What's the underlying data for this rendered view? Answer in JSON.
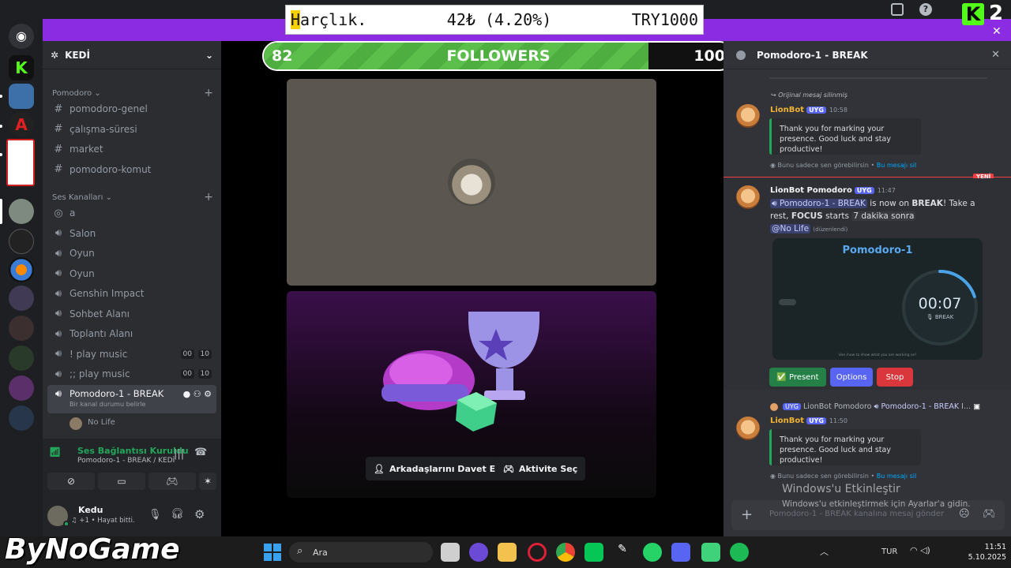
{
  "overlay": {
    "word_initial": "H",
    "word_rest": "arçlık.",
    "amount": "42₺ (4.20%)",
    "goal": "TRY1000"
  },
  "followers": {
    "current": "82",
    "label": "FOLLOWERS",
    "goal": "100",
    "progress_fraction": 0.82
  },
  "kick_count": "2",
  "server": {
    "name": "KEDİ"
  },
  "categories": {
    "text": "Pomodoro",
    "voice": "Ses Kanalları"
  },
  "text_channels": [
    "pomodoro-genel",
    "çalışma-süresi",
    "market",
    "pomodoro-komut"
  ],
  "voice_channels": [
    {
      "name": "a",
      "counts": null
    },
    {
      "name": "Salon",
      "counts": null
    },
    {
      "name": "Oyun",
      "counts": null
    },
    {
      "name": "Oyun",
      "counts": null
    },
    {
      "name": "Genshin Impact",
      "counts": null
    },
    {
      "name": "Sohbet Alanı",
      "counts": null
    },
    {
      "name": "Toplantı Alanı",
      "counts": null
    },
    {
      "name": "! play music",
      "counts": [
        "00",
        "10"
      ]
    },
    {
      "name": ";; play music",
      "counts": [
        "00",
        "10"
      ]
    }
  ],
  "active_channel": {
    "name": "Pomodoro-1 - BREAK",
    "status": "Bir kanal durumu belirle",
    "member": "No Life"
  },
  "voice_panel": {
    "title": "Ses Bağlantısı Kuruldu",
    "subtitle": "Pomodoro-1 - BREAK / KEDİ"
  },
  "user": {
    "name": "Kedu",
    "status": "♫ +1 • Hayat bitti."
  },
  "stage": {
    "invite_label": "Arkadaşlarını Davet Et",
    "activity_label": "Aktivite Seç"
  },
  "chat": {
    "header": "Pomodoro-1 - BREAK",
    "deleted_note": "Orijinal mesaj silinmiş",
    "msg1": {
      "author": "LionBot",
      "tag": "UYG",
      "time": "10:58",
      "text": "Thank you for marking your presence. Good luck and stay productive!"
    },
    "ephemeral_note": "Bunu sadece sen görebilirsin •",
    "dismiss": "Bu mesajı sil",
    "new_label": "YENİ",
    "msg2": {
      "author": "LionBot Pomodoro",
      "tag": "UYG",
      "time": "11:47",
      "channel_mention": "Pomodoro-1 - BREAK",
      "t1": "is now on",
      "t2": "BREAK",
      "t3": "! Take a rest,",
      "t4": "FOCUS",
      "t5": "starts",
      "t6": "7 dakika sonra",
      "mention": "@No Life",
      "edited": "(düzenlendi)"
    },
    "timer": {
      "title": "Pomodoro-1",
      "time": "00:07",
      "phase": "BREAK",
      "tiny_text": "Use /now to show what you are working on!",
      "remaining_fraction": 0.2
    },
    "buttons": [
      "✅ Present",
      "Options",
      "Stop"
    ],
    "reply": {
      "tag": "UYG",
      "author": "LionBot Pomodoro",
      "channel": "Pomodoro-1 - BREAK",
      "more": "I..."
    },
    "msg3": {
      "author": "LionBot",
      "tag": "UYG",
      "time": "11:50",
      "text": "Thank you for marking your presence. Good luck and stay productive!"
    },
    "input_placeholder": "Pomodoro-1 - BREAK kanalına mesaj gönder"
  },
  "activation": {
    "title": "Windows'u Etkinleştir",
    "subtitle": "Windows'u etkinleştirmek için Ayarlar'a gidin."
  },
  "taskbar": {
    "search": "Ara",
    "lang": "TUR",
    "time": "11:51",
    "date": "5.10.2025"
  },
  "watermark": "ByNoGame",
  "colors": {
    "accent_purple": "#8b2be2",
    "discord_blurple": "#5865f2",
    "green": "#23a55a",
    "red": "#da373c"
  }
}
